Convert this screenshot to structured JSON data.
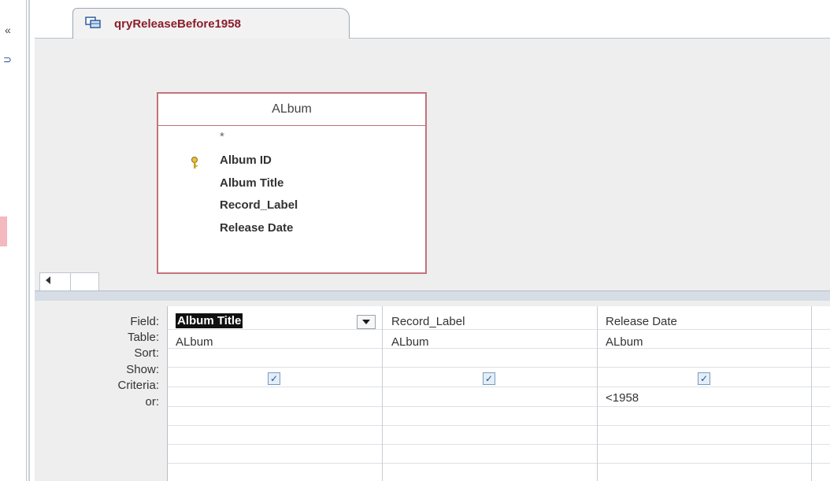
{
  "nav": {
    "collapse_glyph": "«",
    "item_glyph": "⊃"
  },
  "tab": {
    "title": "qryReleaseBefore1958"
  },
  "table": {
    "name": "ALbum",
    "all_fields": "*",
    "fields": [
      "Album ID",
      "Album Title",
      "Record_Label",
      "Release Date"
    ]
  },
  "grid": {
    "row_labels": {
      "field": "Field:",
      "table": "Table:",
      "sort": "Sort:",
      "show": "Show:",
      "criteria": "Criteria:",
      "or": "or:"
    },
    "columns": [
      {
        "field": "Album Title",
        "table": "ALbum",
        "show": true,
        "criteria": ""
      },
      {
        "field": "Record_Label",
        "table": "ALbum",
        "show": true,
        "criteria": ""
      },
      {
        "field": "Release Date",
        "table": "ALbum",
        "show": true,
        "criteria": "<1958"
      }
    ],
    "check_glyph": "✓"
  },
  "colors": {
    "tab_title": "#8b1d2a",
    "table_border": "#c2737b",
    "selection": "#101010"
  }
}
